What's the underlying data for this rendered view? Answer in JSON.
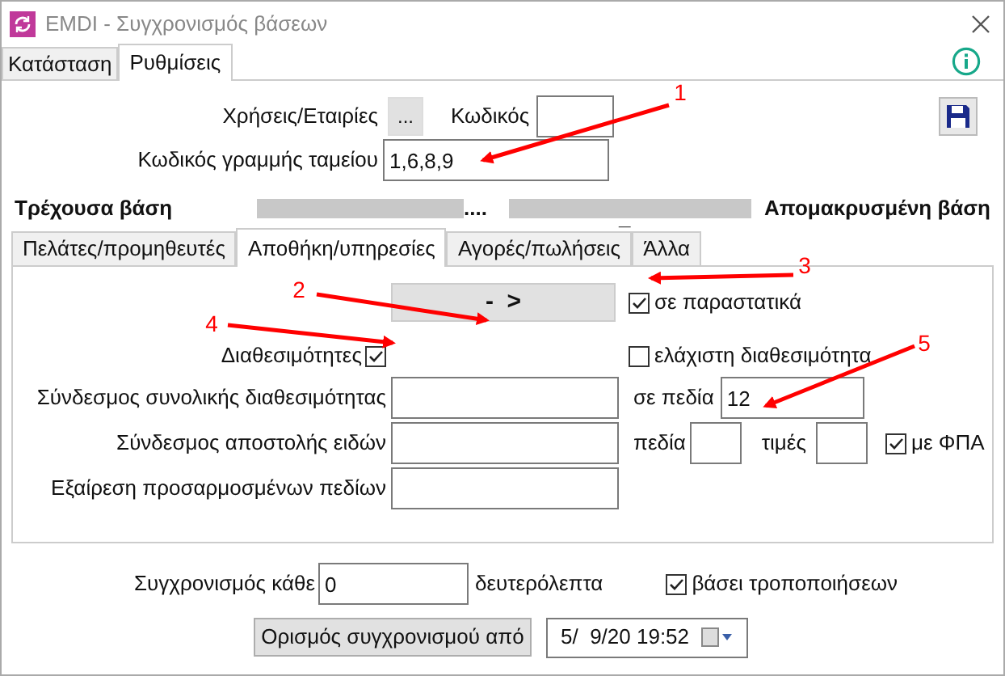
{
  "window": {
    "title": "EMDI - Συγχρονισμός βάσεων"
  },
  "tabs": [
    {
      "label": "Κατάσταση",
      "selected": false
    },
    {
      "label": "Ρυθμίσεις",
      "selected": true
    }
  ],
  "settings": {
    "companies_label": "Χρήσεις/Εταιρίες",
    "browse_button": "...",
    "code_label": "Κωδικός",
    "cash_line_label": "Κωδικός γραμμής ταμείου",
    "cash_line_value": "1,6,8,9"
  },
  "databases": {
    "current_label": "Τρέχουσα βάση",
    "current_suffix": "....",
    "remote_mark": "_",
    "remote_label": "Απομακρυσμένη βάση"
  },
  "subtabs": [
    {
      "label": "Πελάτες/προμηθευτές",
      "selected": false
    },
    {
      "label": "Αποθήκη/υπηρεσίες",
      "selected": true
    },
    {
      "label": "Αγορές/πωλήσεις",
      "selected": false
    },
    {
      "label": "Άλλα",
      "selected": false
    }
  ],
  "warehouse": {
    "transfer_button": "-  >",
    "in_documents": {
      "label": "σε παραστατικά",
      "checked": true
    },
    "availability": {
      "label": "Διαθεσιμότητες",
      "checked": true
    },
    "minimum_availability": {
      "label": "ελάχιστη διαθεσιμότητα",
      "checked": false
    },
    "total_availability_link": {
      "label": "Σύνδεσμος συνολικής διαθεσιμότητας"
    },
    "in_fields_label": "σε πεδία",
    "in_fields_value": "12",
    "item_dispatch_link": {
      "label": "Σύνδεσμος αποστολής ειδών"
    },
    "fields_label": "πεδία",
    "prices_label": "τιμές",
    "with_vat": {
      "label": "με ΦΠΑ",
      "checked": true
    },
    "exclude_custom_fields": {
      "label": "Εξαίρεση προσαρμοσμένων πεδίων"
    }
  },
  "sync": {
    "every_label": "Συγχρονισμός κάθε",
    "every_value": "0",
    "seconds_label": "δευτερόλεπτα",
    "by_changes": {
      "label": "βάσει τροποποιήσεων",
      "checked": true
    },
    "set_from_button": "Ορισμός συγχρονισμού από",
    "date_value": "5/  9/20 19:52"
  },
  "annotations": [
    {
      "label": "1"
    },
    {
      "label": "2"
    },
    {
      "label": "3"
    },
    {
      "label": "4"
    },
    {
      "label": "5"
    }
  ]
}
